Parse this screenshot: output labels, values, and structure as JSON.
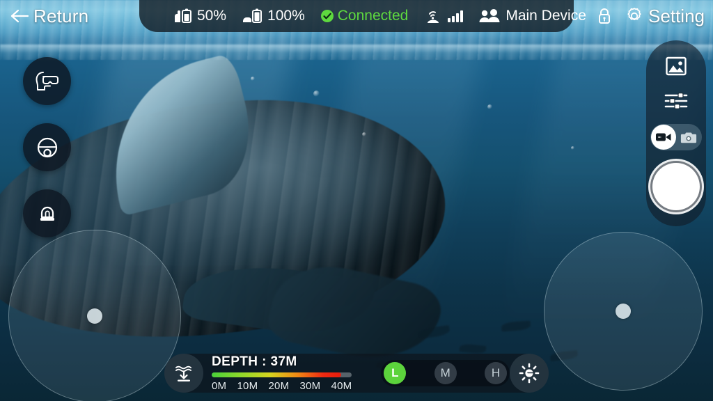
{
  "app": {
    "title": "Underwater Drone Camera Control"
  },
  "topbar": {
    "return_label": "Return",
    "return_icon": "arrow-left-icon",
    "rov_battery": {
      "icon": "rov-battery-icon",
      "value": "50%"
    },
    "buoy_battery": {
      "icon": "buoy-battery-icon",
      "value": "100%"
    },
    "connection": {
      "icon": "check-circle-icon",
      "label": "Connected",
      "color": "#5ed93f"
    },
    "signal": {
      "icon": "wifi-buoy-icon",
      "bars": 4
    },
    "device": {
      "icon": "users-icon",
      "label": "Main Device"
    },
    "lock_icon": "lock-icon",
    "setting_label": "Setting",
    "setting_icon": "gear-icon"
  },
  "left_rail": {
    "items": [
      {
        "name": "vr-mode-button",
        "icon": "vr-headset-icon",
        "label": "VR Mode"
      },
      {
        "name": "steering-mode-button",
        "icon": "steering-wheel-icon",
        "label": "Steering"
      },
      {
        "name": "lamp-button",
        "icon": "lamp-icon",
        "label": "Lamp"
      }
    ]
  },
  "right_panel": {
    "gallery_icon": "gallery-icon",
    "sliders_icon": "sliders-icon",
    "mode": {
      "selected": "video",
      "options": [
        {
          "value": "video",
          "icon": "video-camera-icon",
          "label": "Video"
        },
        {
          "value": "photo",
          "icon": "photo-camera-icon",
          "label": "Photo"
        }
      ]
    },
    "shutter_label": "Record",
    "shutter_icon": "shutter-button-icon"
  },
  "joysticks": {
    "left": {
      "name": "left-joystick",
      "label": "Left Joystick"
    },
    "right": {
      "name": "right-joystick",
      "label": "Right Joystick"
    }
  },
  "bottom_bar": {
    "depth_hold_icon": "depth-hold-icon",
    "depth_label": "DEPTH : 37M",
    "light_icon": "brightness-icon",
    "speed": {
      "selected": "L",
      "options": [
        "L",
        "M",
        "H"
      ],
      "active_color": "#5cd33c"
    }
  },
  "chart_data": {
    "type": "bar",
    "title": "DEPTH : 37M",
    "categories": [
      "0M",
      "10M",
      "20M",
      "30M",
      "40M"
    ],
    "values": [
      37
    ],
    "xlabel": "Depth",
    "ylabel": "",
    "xlim": [
      0,
      40
    ],
    "unit": "M",
    "current_value": 37,
    "fill_percent": 92.5,
    "gradient_stops": [
      "#49d13a",
      "#8fd92b",
      "#d6d41f",
      "#f08a14",
      "#ef2a12"
    ],
    "grid": false,
    "legend": "none"
  }
}
